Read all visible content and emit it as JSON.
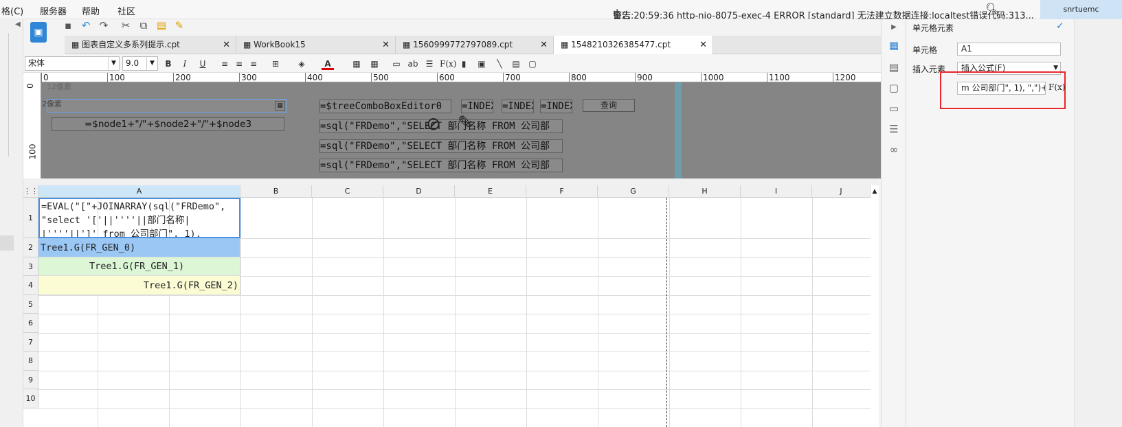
{
  "menu": {
    "grid_fragment": "格(C)",
    "server": "服务器",
    "help": "帮助",
    "community": "社区"
  },
  "log": {
    "label": "日志",
    "separator": "|",
    "message": "警告:20:59:36 http-nio-8075-exec-4 ERROR [standard] 无法建立数据连接:localtest错误代码:313..."
  },
  "user": "snrtuemc",
  "tabs": [
    {
      "label": "图表自定义多系列提示.cpt",
      "active": false
    },
    {
      "label": "WorkBook15",
      "active": false
    },
    {
      "label": "1560999772797089.cpt",
      "active": false
    },
    {
      "label": "1548210326385477.cpt",
      "active": true
    }
  ],
  "format": {
    "font": "宋体",
    "size": "9.0",
    "bold": "B",
    "italic": "I",
    "underline": "U",
    "text_ab": "ab",
    "fx": "F(x)"
  },
  "ruler": {
    "ticks": [
      "0",
      "100",
      "200",
      "300",
      "400",
      "500",
      "600",
      "700",
      "800",
      "900",
      "1000",
      "1100",
      "1200"
    ],
    "vticks": [
      "0",
      "100"
    ]
  },
  "param_panel": {
    "label1": "12像素",
    "label2": "2像素",
    "node_formula": "=$node1+\"/\"+$node2+\"/\"+$node3",
    "tree_editor": "=$treeComboBoxEditor0",
    "index1": "=INDEX",
    "index2": "=INDEX",
    "index3": "=INDEX",
    "query_button": "查询",
    "sql1": "=sql(\"FRDemo\",\"SELECT 部门名称 FROM 公司部",
    "sql2": "=sql(\"FRDemo\",\"SELECT 部门名称 FROM 公司部",
    "sql3": "=sql(\"FRDemo\",\"SELECT 部门名称 FROM 公司部"
  },
  "grid": {
    "columns": [
      "A",
      "B",
      "C",
      "D",
      "E",
      "F",
      "G",
      "H",
      "I",
      "J"
    ],
    "rows": [
      "1",
      "2",
      "3",
      "4",
      "5",
      "6",
      "7",
      "8",
      "9",
      "10"
    ],
    "a1_line1": "=EVAL(\"[\"+JOINARRAY(sql(\"FRDemo\",",
    "a1_line2": "\"select '['||''''||部门名称|",
    "a1_line3": "|''''||']' from 公司部门\", 1),",
    "a2": "Tree1.G(FR_GEN_0)",
    "a3": "Tree1.G(FR_GEN_1)",
    "a4": "Tree1.G(FR_GEN_2)"
  },
  "right_panel": {
    "title": "单元格元素",
    "cell_label": "单元格",
    "cell_value": "A1",
    "insert_label": "插入元素",
    "insert_value": "插入公式(F)",
    "formula_value": "m 公司部门\", 1), \",\")+\"]\")",
    "fx": "F(x)"
  },
  "colors": {
    "blue_row": "#9bc7f5",
    "green_row": "#dcf6d6",
    "yellow_row": "#fbfbd4",
    "highlight": "#e8252b",
    "param_bg": "#858585"
  }
}
